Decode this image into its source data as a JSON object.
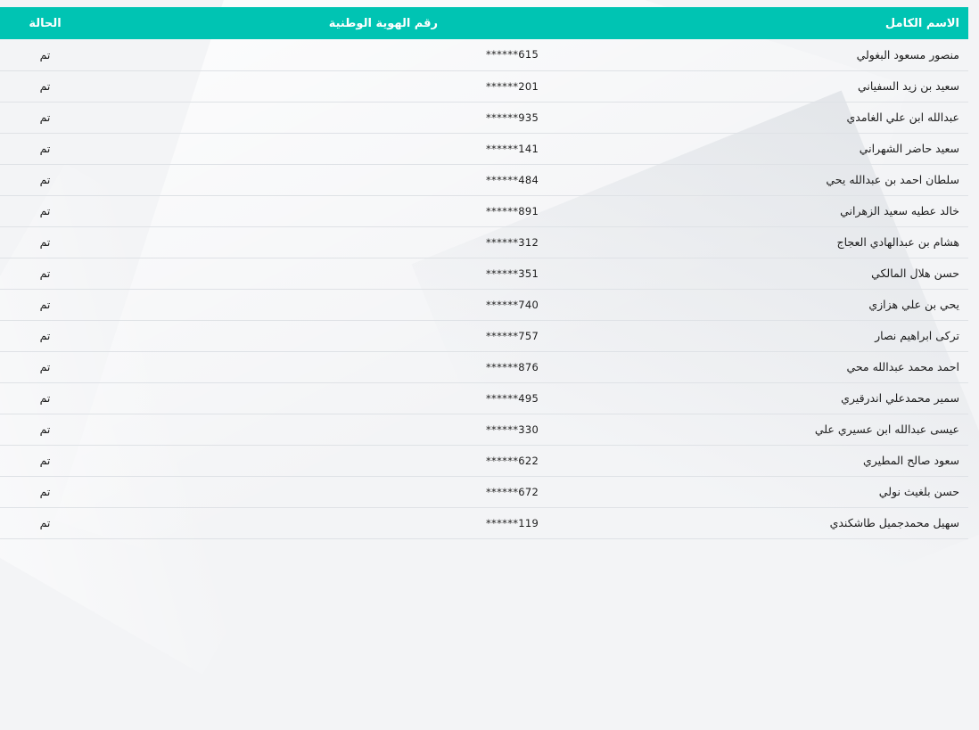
{
  "table": {
    "headers": {
      "name": "الاسم الكامل",
      "id": "رقم الهوية الوطنية",
      "status": "الحالة"
    },
    "rows": [
      {
        "name": "منصور مسعود البغولي",
        "id": "******615",
        "status": "تم"
      },
      {
        "name": "سعيد بن زيد السفياني",
        "id": "******201",
        "status": "تم"
      },
      {
        "name": "عبدالله ابن علي الغامدي",
        "id": "******935",
        "status": "تم"
      },
      {
        "name": "سعيد حاضر الشهراني",
        "id": "******141",
        "status": "تم"
      },
      {
        "name": "سلطان احمد بن عبدالله يحي",
        "id": "******484",
        "status": "تم"
      },
      {
        "name": "خالد عطيه سعيد الزهراني",
        "id": "******891",
        "status": "تم"
      },
      {
        "name": "هشام بن عبدالهادي العجاج",
        "id": "******312",
        "status": "تم"
      },
      {
        "name": "حسن هلال المالكي",
        "id": "******351",
        "status": "تم"
      },
      {
        "name": "يحي بن علي هزازي",
        "id": "******740",
        "status": "تم"
      },
      {
        "name": "تركى ابراهيم نصار",
        "id": "******757",
        "status": "تم"
      },
      {
        "name": "احمد محمد عبدالله محي",
        "id": "******876",
        "status": "تم"
      },
      {
        "name": "سمير محمدعلي اندرقيري",
        "id": "******495",
        "status": "تم"
      },
      {
        "name": "عيسى عبدالله ابن عسيري علي",
        "id": "******330",
        "status": "تم"
      },
      {
        "name": "سعود صالح المطيري",
        "id": "******622",
        "status": "تم"
      },
      {
        "name": "حسن بلغيث نولي",
        "id": "******672",
        "status": "تم"
      },
      {
        "name": "سهيل محمدجميل طاشكندي",
        "id": "******119",
        "status": "تم"
      }
    ]
  },
  "colors": {
    "header_bg": "#00c4b3",
    "header_text": "#ffffff",
    "page_bg": "#f3f4f6"
  }
}
